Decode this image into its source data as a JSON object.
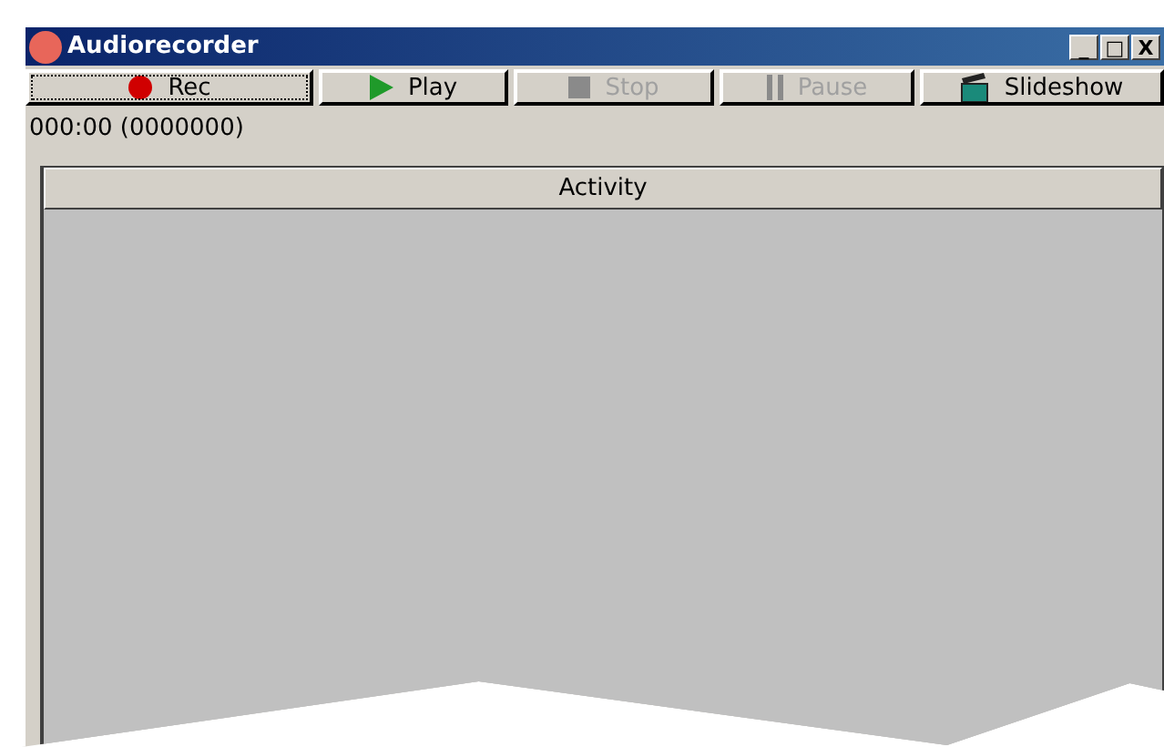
{
  "window": {
    "title": "Audiorecorder",
    "controls": [
      "_",
      "□",
      "X"
    ]
  },
  "toolbar": [
    {
      "label": "Rec",
      "kind": "record",
      "focused": true,
      "disabled": false
    },
    {
      "label": "Play",
      "kind": "play",
      "focused": false,
      "disabled": false
    },
    {
      "label": "Stop",
      "kind": "stop",
      "focused": false,
      "disabled": true
    },
    {
      "label": "Pause",
      "kind": "pause",
      "focused": false,
      "disabled": true
    },
    {
      "label": "Slideshow",
      "kind": "slideshow",
      "focused": false,
      "disabled": false
    }
  ],
  "position": "000:00 (0000000)",
  "list": {
    "columns": [
      "Activity"
    ]
  }
}
